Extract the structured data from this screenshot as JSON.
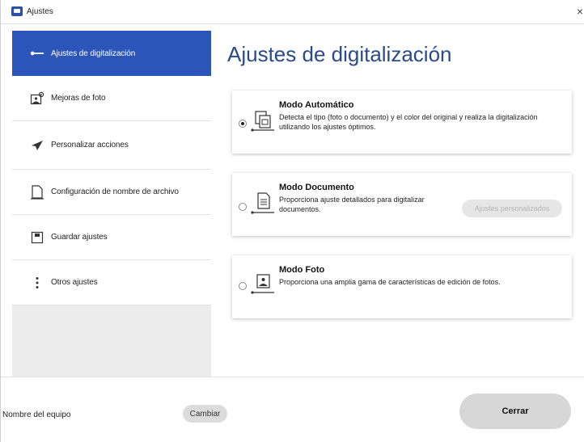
{
  "window": {
    "title": "Ajustes",
    "close_glyph": "×"
  },
  "sidebar": {
    "items": [
      {
        "label": "Ajustes de digitalización",
        "icon": "scan-settings-icon",
        "active": true
      },
      {
        "label": "Mejoras de foto",
        "icon": "photo-enhance-icon",
        "active": false
      },
      {
        "label": "Personalizar acciones",
        "icon": "send-icon",
        "active": false
      },
      {
        "label": "Configuración de nombre de archivo",
        "icon": "document-icon",
        "active": false
      },
      {
        "label": "Guardar ajustes",
        "icon": "save-icon",
        "active": false
      },
      {
        "label": "Otros ajustes",
        "icon": "more-vertical-icon",
        "active": false
      }
    ]
  },
  "main": {
    "title": "Ajustes de digitalización",
    "modes": [
      {
        "title": "Modo Automático",
        "description": "Detecta el tipo (foto o documento) y el color del original y realiza la digitalización utilizando los ajustes óptimos.",
        "selected": true,
        "icon": "auto-mode-icon"
      },
      {
        "title": "Modo Documento",
        "description": "Proporciona ajuste detallados para digitalizar documentos.",
        "selected": false,
        "icon": "document-mode-icon",
        "button_label": "Ajustes personalizados"
      },
      {
        "title": "Modo Foto",
        "description": "Proporciona una amplia gama de características de edición de fotos.",
        "selected": false,
        "icon": "photo-mode-icon"
      }
    ]
  },
  "footer": {
    "device_label": "Nombre del equipo",
    "change_label": "Cambiar",
    "close_label": "Cerrar"
  },
  "colors": {
    "accent": "#2b55b8",
    "title": "#2a4a88",
    "sidebar_bg": "#ececec"
  }
}
